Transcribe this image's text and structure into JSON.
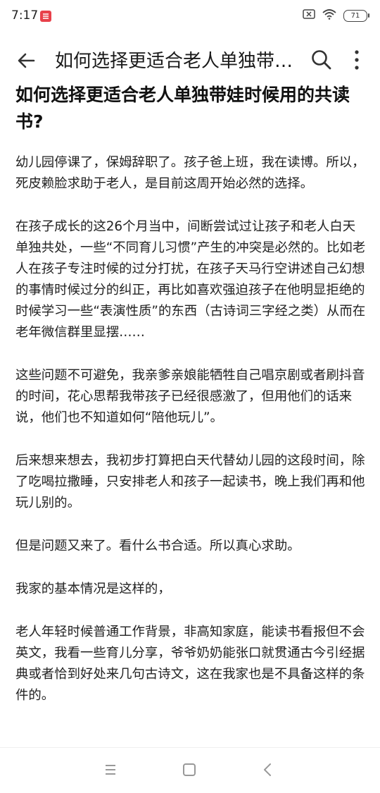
{
  "status_bar": {
    "time": "7:17",
    "battery": "71"
  },
  "app_bar": {
    "title": "如何选择更适合老人单独带娃时候用的共读书?"
  },
  "question": {
    "title": "如何选择更适合老人单独带娃时候用的共读书?"
  },
  "answer": {
    "paragraphs": [
      "幼儿园停课了，保姆辞职了。孩子爸上班，我在读博。所以，死皮赖脸求助于老人，是目前这周开始必然的选择。",
      "在孩子成长的这26个月当中，间断尝试过让孩子和老人白天单独共处，一些“不同育儿习惯”产生的冲突是必然的。比如老人在孩子专注时候的过分打扰，在孩子天马行空讲述自己幻想的事情时候过分的纠正，再比如喜欢强迫孩子在他明显拒绝的时候学习一些“表演性质”的东西（古诗词三字经之类）从而在老年微信群里显摆……",
      "这些问题不可避免，我亲爹亲娘能牺牲自己唱京剧或者刷抖音的时间，花心思帮我带孩子已经很感激了，但用他们的话来说，他们也不知道如何“陪他玩儿”。",
      "后来想来想去，我初步打算把白天代替幼儿园的这段时间，除了吃喝拉撒睡，只安排老人和孩子一起读书，晚上我们再和他玩儿别的。",
      "但是问题又来了。看什么书合适。所以真心求助。",
      "我家的基本情况是这样的，",
      "老人年轻时候普通工作背景，非高知家庭，能读书看报但不会英文，我看一些育儿分享，爷爷奶奶能张口就贯通古今引经据典或者恰到好处来几句古诗文，这在我家也是不具备这样的条件的。"
    ]
  },
  "colors": {
    "app_icon": "#e8404a",
    "text": "#222222",
    "icon": "#444444"
  }
}
